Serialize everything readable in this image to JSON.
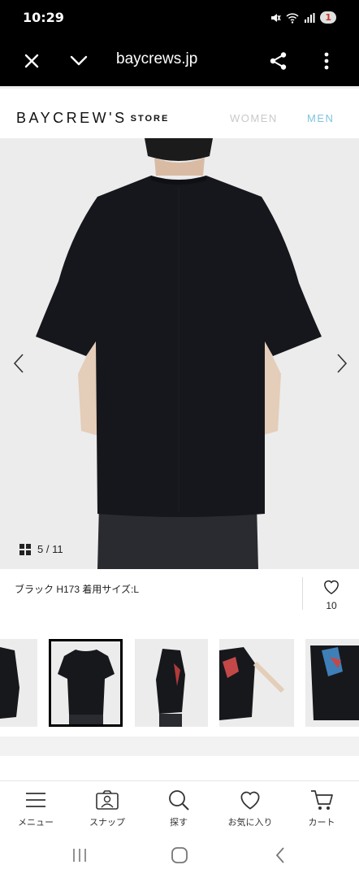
{
  "status_bar": {
    "time": "10:29",
    "battery": "1"
  },
  "browser": {
    "url": "baycrews.jp"
  },
  "site": {
    "logo": "BAYCREW'S",
    "logo_store": "STORE",
    "nav": {
      "women": "WOMEN",
      "men": "MEN"
    }
  },
  "gallery": {
    "counter": "5 / 11"
  },
  "product": {
    "caption": "ブラック H173 着用サイズ:L",
    "fav_count": "10"
  },
  "tabs": [
    {
      "label": "メニュー",
      "icon": "menu-icon"
    },
    {
      "label": "スナップ",
      "icon": "snap-icon"
    },
    {
      "label": "探す",
      "icon": "search-icon"
    },
    {
      "label": "お気に入り",
      "icon": "heart-icon"
    },
    {
      "label": "カート",
      "icon": "cart-icon"
    }
  ],
  "colors": {
    "accent_men": "#7fc4df",
    "nav_inactive": "#c9c9c9",
    "garment": "#16171c"
  }
}
